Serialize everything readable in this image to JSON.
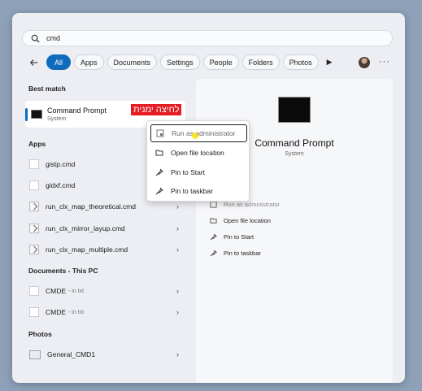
{
  "search": {
    "value": "cmd"
  },
  "filters": [
    "All",
    "Apps",
    "Documents",
    "Settings",
    "People",
    "Folders",
    "Photos"
  ],
  "best_match": {
    "heading": "Best match",
    "title": "Command Prompt",
    "subtitle": "System",
    "annotation": "לחיצה ימנית"
  },
  "apps": {
    "heading": "Apps",
    "items": [
      "gistp.cmd",
      "gidxf.cmd",
      "run_clx_map_theoretical.cmd",
      "run_clx_mirror_layup.cmd",
      "run_clx_map_multiple.cmd"
    ]
  },
  "documents": {
    "heading": "Documents - This PC",
    "items": [
      {
        "name": "CMDE",
        "location": "- in txt"
      },
      {
        "name": "CMDE",
        "location": "- in txt"
      }
    ]
  },
  "photos": {
    "heading": "Photos",
    "items": [
      "General_CMD1"
    ]
  },
  "context_menu": [
    "Run as administrator",
    "Open file location",
    "Pin to Start",
    "Pin to taskbar"
  ],
  "detail": {
    "title": "Command Prompt",
    "subtitle": "System",
    "actions": [
      "Run as administrator",
      "Open file location",
      "Pin to Start",
      "Pin to taskbar"
    ]
  },
  "colors": {
    "accent": "#0f6cbd",
    "annotation": "#e51c23"
  }
}
